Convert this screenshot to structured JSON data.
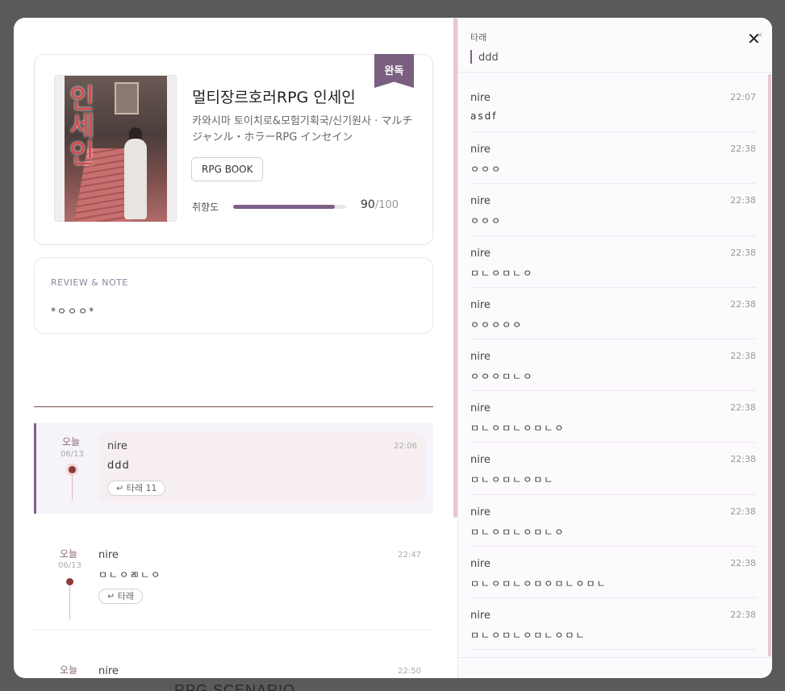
{
  "background_text": "RPG SCENARIO",
  "book": {
    "badge": "완독",
    "title": "멀티장르호러RPG 인세인",
    "author": "카와시마 토이치로&모험기획국/신기원사 · マルチジャンル・ホラーRPG インセイン",
    "tag": "RPG BOOK",
    "cover_text": "인세인",
    "preference": {
      "label": "취향도",
      "value": "90",
      "max": "/100",
      "fraction": 0.9
    }
  },
  "review": {
    "heading": "REVIEW & NOTE",
    "body": "*ㅇㅇㅇ*"
  },
  "entries": [
    {
      "today": "오늘",
      "date": "06/13",
      "author": "nire",
      "time": "22:06",
      "text": "ddd",
      "reply": "타래 11"
    },
    {
      "today": "오늘",
      "date": "06/13",
      "author": "nire",
      "time": "22:47",
      "text": "ㅁㄴㅇㄻㄴㅇ",
      "reply": "타래"
    },
    {
      "today": "오늘",
      "author": "nire",
      "time": "22:50"
    }
  ],
  "thread": {
    "label": "타래",
    "input_value": "ddd",
    "close": "×",
    "items": [
      {
        "author": "nire",
        "time": "22:07",
        "text": "asdf"
      },
      {
        "author": "nire",
        "time": "22:38",
        "text": "ㅇㅇㅇ"
      },
      {
        "author": "nire",
        "time": "22:38",
        "text": "ㅇㅇㅇ"
      },
      {
        "author": "nire",
        "time": "22:38",
        "text": "ㅁㄴㅇㅁㄴㅇ"
      },
      {
        "author": "nire",
        "time": "22:38",
        "text": "ㅇㅇㅇㅇㅇ"
      },
      {
        "author": "nire",
        "time": "22:38",
        "text": "ㅇㅇㅇㅁㄴㅇ"
      },
      {
        "author": "nire",
        "time": "22:38",
        "text": "ㅁㄴㅇㅁㄴㅇㅁㄴㅇ"
      },
      {
        "author": "nire",
        "time": "22:38",
        "text": "ㅁㄴㅇㅁㄴㅇㅁㄴ"
      },
      {
        "author": "nire",
        "time": "22:38",
        "text": "ㅁㄴㅇㅁㄴㅇㅁㄴㅇ"
      },
      {
        "author": "nire",
        "time": "22:38",
        "text": "ㅁㄴㅇㅁㄴㅇㅁㅇㅁㄴㅇㅁㄴ"
      },
      {
        "author": "nire",
        "time": "22:38",
        "text": "ㅁㄴㅇㅁㄴㅇㅁㄴㅇㅁㄴ"
      }
    ]
  },
  "colors": {
    "accent": "#7b6186",
    "dot": "#8f3a3a",
    "scroll": "#e7c9cc"
  }
}
